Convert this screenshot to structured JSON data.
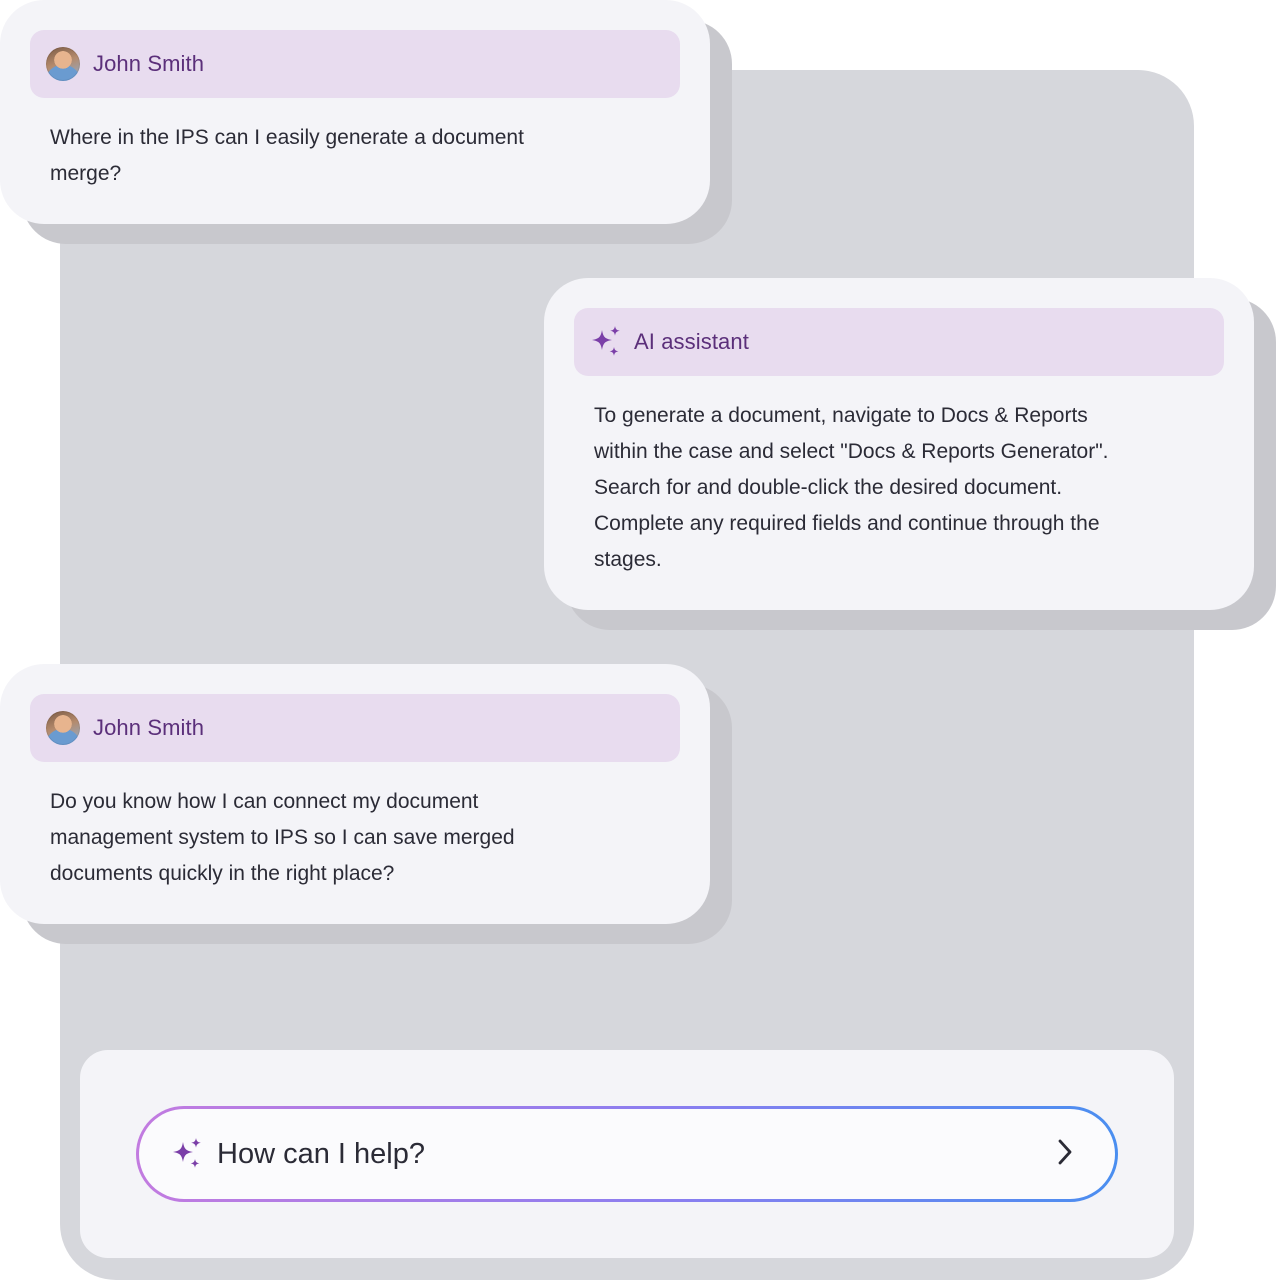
{
  "messages": [
    {
      "sender": "John Smith",
      "text": "Where in the IPS can I easily generate a document\nmerge?"
    },
    {
      "sender": "AI assistant",
      "text": "To generate a document, navigate to Docs & Reports\nwithin the case and select \"Docs & Reports Generator\".\nSearch for and double-click the desired document.\nComplete any required fields and continue through the\nstages."
    },
    {
      "sender": "John Smith",
      "text": "Do you know how I can connect my document\nmanagement system to IPS so I can save merged\ndocuments quickly in the right place?"
    }
  ],
  "composer": {
    "placeholder": "How can I help?",
    "send_icon": "chevron-right-icon",
    "sparkle_icon": "sparkle-icon"
  },
  "colors": {
    "header_bg": "#e8dcef",
    "sender_name": "#5b2f7a",
    "sparkle": "#7b3fa8",
    "bubble_bg": "#f4f4f8",
    "backdrop": "#d6d7dc",
    "input_gradient_start": "#c27be0",
    "input_gradient_end": "#4a8ef0"
  }
}
